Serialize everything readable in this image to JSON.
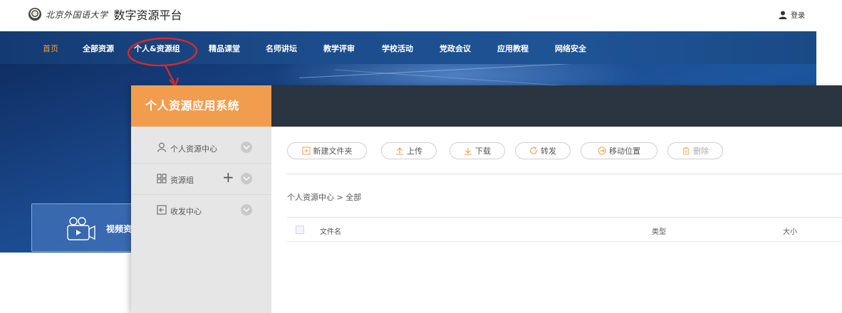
{
  "portal": {
    "logo_text": "北京外国语大学",
    "title": "数字资源平台",
    "login_label": "登录",
    "nav": [
      {
        "label": "首页"
      },
      {
        "label": "全部资源"
      },
      {
        "label": "个人&资源组"
      },
      {
        "label": "精品课堂"
      },
      {
        "label": "名师讲坛"
      },
      {
        "label": "教学评审"
      },
      {
        "label": "学校活动"
      },
      {
        "label": "党政会议"
      },
      {
        "label": "应用教程"
      },
      {
        "label": "网络安全"
      }
    ],
    "video_card_label": "视频资"
  },
  "app": {
    "brand": "个人资源应用系统",
    "sidebar": [
      {
        "label": "个人资源中心",
        "icon": "user-icon"
      },
      {
        "label": "资源组",
        "icon": "grid-icon"
      },
      {
        "label": "收发中心",
        "icon": "sign-in-icon"
      }
    ],
    "toolbar": [
      {
        "label": "新建文件夹",
        "icon": "new-folder-icon"
      },
      {
        "label": "上传",
        "icon": "upload-icon"
      },
      {
        "label": "下载",
        "icon": "download-icon"
      },
      {
        "label": "转发",
        "icon": "forward-icon"
      },
      {
        "label": "移动位置",
        "icon": "move-icon"
      },
      {
        "label": "删除",
        "icon": "trash-icon"
      }
    ],
    "breadcrumb": "个人资源中心 > 全部",
    "table_headers": {
      "name": "文件名",
      "type": "类型",
      "size": "大小"
    }
  },
  "colors": {
    "accent_orange": "#f29d4d",
    "nav_active": "#f0a14a",
    "nav_bg": "#1c4d8c",
    "app_header": "#2b3441",
    "annotation_red": "#d62b2b"
  }
}
